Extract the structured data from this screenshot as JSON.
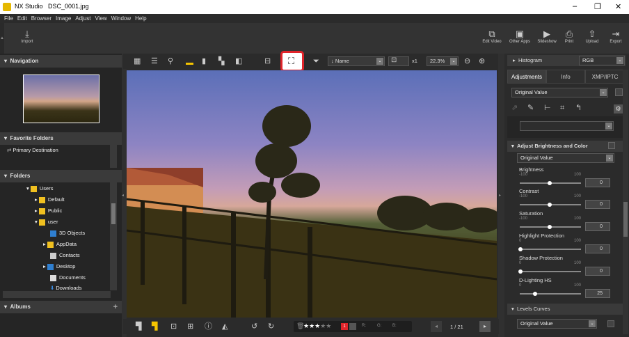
{
  "titlebar": {
    "app": "NX Studio",
    "file": "DSC_0001.jpg"
  },
  "menu": [
    "File",
    "Edit",
    "Browser",
    "Image",
    "Adjust",
    "View",
    "Window",
    "Help"
  ],
  "toolbar": {
    "import": "Import",
    "right": [
      {
        "label": "Edit Video",
        "icon": "film-edit-icon"
      },
      {
        "label": "Other Apps",
        "icon": "apps-icon"
      },
      {
        "label": "Slideshow",
        "icon": "slideshow-icon"
      },
      {
        "label": "Print",
        "icon": "printer-icon"
      },
      {
        "label": "Upload",
        "icon": "upload-icon"
      },
      {
        "label": "Export",
        "icon": "export-icon"
      }
    ]
  },
  "left": {
    "navigation": "Navigation",
    "favorites": "Favorite Folders",
    "primary_destination": "Primary Destination",
    "folders": "Folders",
    "tree": [
      "Users",
      "Default",
      "Public",
      "user",
      "3D Objects",
      "AppData",
      "Contacts",
      "Desktop",
      "Documents",
      "Downloads"
    ],
    "albums": "Albums"
  },
  "viewbar": {
    "sort": "Name",
    "zoom_x": "x1",
    "zoom_pct": "22.3%"
  },
  "bottombar": {
    "label_r": "R:",
    "label_g": "G:",
    "label_b": "B:",
    "page": "1 / 21",
    "rating_label": "1"
  },
  "right": {
    "histogram": "Histogram",
    "histogram_mode": "RGB",
    "tabs": [
      "Adjustments",
      "Info",
      "XMP/IPTC"
    ],
    "preset": "Original Value",
    "section_bc": "Adjust Brightness and Color",
    "section_bc_value": "Original Value",
    "sliders": [
      {
        "name": "Brightness",
        "min": "-100",
        "max": "100",
        "value": "0"
      },
      {
        "name": "Contrast",
        "min": "-100",
        "max": "100",
        "value": "0"
      },
      {
        "name": "Saturation",
        "min": "-100",
        "max": "100",
        "value": "0"
      },
      {
        "name": "Highlight Protection",
        "min": "0",
        "max": "100",
        "value": "0"
      },
      {
        "name": "Shadow Protection",
        "min": "0",
        "max": "100",
        "value": "0"
      },
      {
        "name": "D-Lighting HS",
        "min": "0",
        "max": "100",
        "value": "25"
      }
    ],
    "levels": "Levels Curves",
    "levels_value": "Original Value"
  },
  "colors": {
    "highlight": "#e0242a",
    "accent": "#f5c400"
  }
}
